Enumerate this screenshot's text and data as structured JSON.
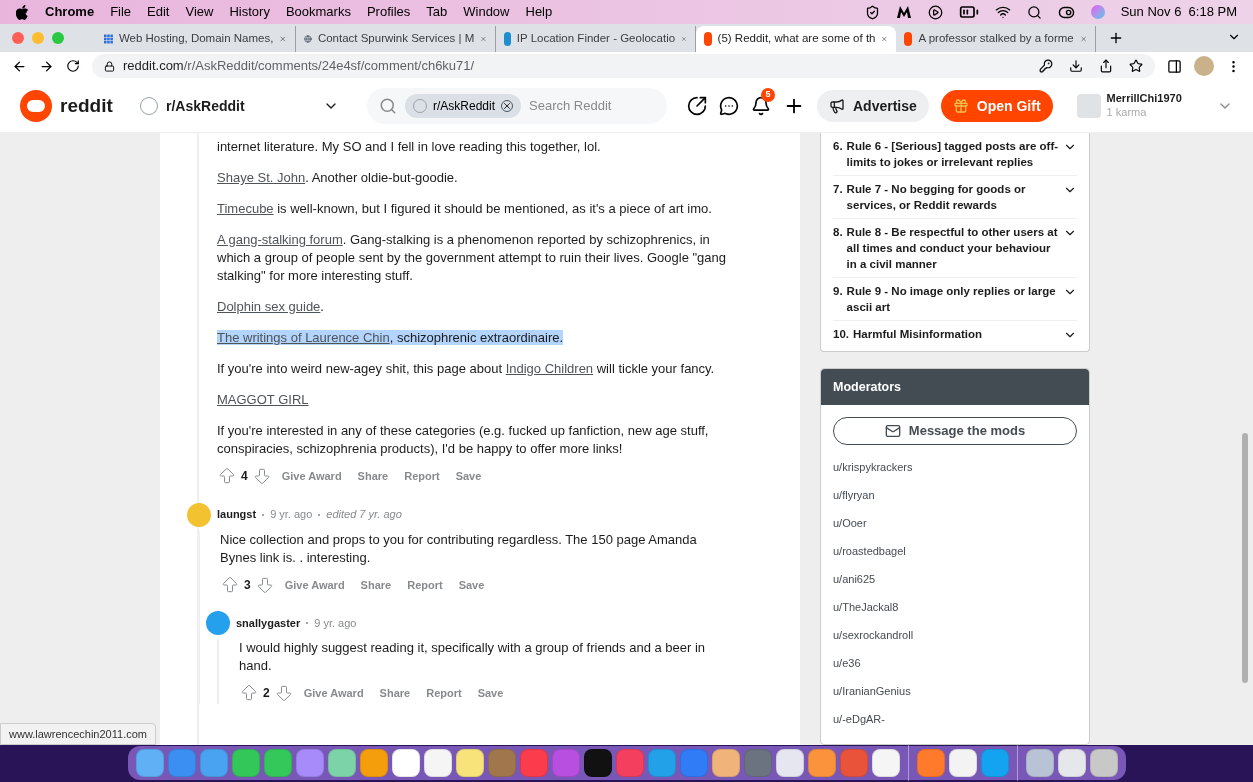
{
  "menubar": {
    "app": "Chrome",
    "menus": [
      "File",
      "Edit",
      "View",
      "History",
      "Bookmarks",
      "Profiles",
      "Tab",
      "Window",
      "Help"
    ],
    "clock": "Sun Nov 6  6:18 PM"
  },
  "tabs": [
    {
      "title": "Web Hosting, Domain Names, ",
      "selected": false,
      "kind": "grid"
    },
    {
      "title": "Contact Spurwink Services | M",
      "selected": false,
      "kind": "globe"
    },
    {
      "title": "IP Location Finder - Geolocatio",
      "selected": false,
      "kind": "ip"
    },
    {
      "title": "(5) Reddit, what are some of th",
      "selected": true,
      "kind": "reddit"
    },
    {
      "title": "A professor stalked by a forme",
      "selected": false,
      "kind": "reddit"
    }
  ],
  "address": {
    "host": "reddit.com",
    "path": "/r/AskReddit/comments/24e4sf/comment/ch6ku71/"
  },
  "header": {
    "logo": "reddit",
    "community": "r/AskReddit",
    "search_chip": "r/AskReddit",
    "search_placeholder": "Search Reddit",
    "notifications": "5",
    "advertise": "Advertise",
    "gift": "Open Gift",
    "username": "MerrillChi1970",
    "karma": "1 karma"
  },
  "comment": {
    "paragraphs": [
      {
        "highlighted": false,
        "segments": [
          {
            "text": "internet literature. My SO and I fell in love reading this together, lol.",
            "link": false
          }
        ]
      },
      {
        "highlighted": false,
        "segments": [
          {
            "text": "Shaye St. John",
            "link": true
          },
          {
            "text": ". Another oldie-but-goodie.",
            "link": false
          }
        ]
      },
      {
        "highlighted": false,
        "segments": [
          {
            "text": "Timecube",
            "link": true
          },
          {
            "text": " is well-known, but I figured it should be mentioned, as it's a piece of art imo.",
            "link": false
          }
        ]
      },
      {
        "highlighted": false,
        "segments": [
          {
            "text": "A gang-stalking forum",
            "link": true
          },
          {
            "text": ". Gang-stalking is a phenomenon reported by schizophrenics, in which a group of people sent by the government attempt to ruin their lives. Google \"gang stalking\" for more interesting stuff.",
            "link": false
          }
        ]
      },
      {
        "highlighted": false,
        "segments": [
          {
            "text": "Dolphin sex guide",
            "link": true
          },
          {
            "text": ".",
            "link": false
          }
        ]
      },
      {
        "highlighted": true,
        "segments": [
          {
            "text": "The writings of Laurence Chin",
            "link": true
          },
          {
            "text": ", schizophrenic extraordinaire.",
            "link": false
          }
        ]
      },
      {
        "highlighted": false,
        "segments": [
          {
            "text": "If you're into weird new-agey shit, this page about ",
            "link": false
          },
          {
            "text": "Indigo Children",
            "link": true
          },
          {
            "text": " will tickle your fancy.",
            "link": false
          }
        ]
      },
      {
        "highlighted": false,
        "segments": [
          {
            "text": "MAGGOT GIRL",
            "link": true
          }
        ]
      },
      {
        "highlighted": false,
        "segments": [
          {
            "text": "If you're interested in any of these categories (e.g. fucked up fanfiction, new age stuff, conspiracies, schizophrenia products), I'd be happy to offer more links!",
            "link": false
          }
        ]
      }
    ],
    "score": "4",
    "actions": [
      "Give Award",
      "Share",
      "Report",
      "Save"
    ]
  },
  "replies": [
    {
      "author": "laungst",
      "time": "9 yr. ago",
      "edited": "edited 7 yr. ago",
      "color": "#f2c230",
      "body": "Nice collection and props to you for contributing regardless. The 150 page Amanda Bynes link is. . interesting.",
      "score": "3",
      "actions": [
        "Give Award",
        "Share",
        "Report",
        "Save"
      ],
      "children": [
        {
          "author": "snallygaster",
          "time": "9 yr. ago",
          "color": "#24a0ed",
          "body": "I would highly suggest reading it, specifically with a group of friends and a beer in hand.",
          "score": "2",
          "actions": [
            "Give Award",
            "Share",
            "Report",
            "Save"
          ]
        }
      ]
    }
  ],
  "sidebar": {
    "rules": [
      {
        "number": "6.",
        "text": "Rule 6 - [Serious] tagged posts are off-limits to jokes or irrelevant replies"
      },
      {
        "number": "7.",
        "text": "Rule 7 - No begging for goods or services, or Reddit rewards"
      },
      {
        "number": "8.",
        "text": "Rule 8 - Be respectful to other users at all times and conduct your behaviour in a civil manner"
      },
      {
        "number": "9.",
        "text": "Rule 9 - No image only replies or large ascii art"
      },
      {
        "number": "10.",
        "text": "Harmful Misinformation"
      }
    ],
    "moderators": {
      "title": "Moderators",
      "button": "Message the mods",
      "users": [
        "u/krispykrackers",
        "u/flyryan",
        "u/Ooer",
        "u/roastedbagel",
        "u/ani625",
        "u/TheJackal8",
        "u/sexrockandroll",
        "u/e36",
        "u/IranianGenius",
        "u/-eDgAR-"
      ]
    }
  },
  "status_url": "www.lawrencechin2011.com"
}
